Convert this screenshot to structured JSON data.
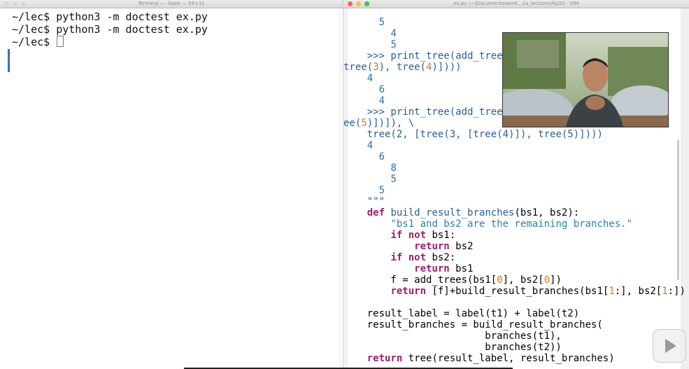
{
  "terminal": {
    "title": "Terminal — -bash — 54×31",
    "prompt": "~/lec$",
    "lines": [
      {
        "prompt": "~/lec$",
        "command": " python3 -m doctest ex.py"
      },
      {
        "prompt": "~/lec$",
        "command": " python3 -m doctest ex.py"
      },
      {
        "prompt": "~/lec$",
        "command": " "
      }
    ]
  },
  "vim": {
    "title": "ex.py (~/Documents/work...1a_lectures/fa20) - VIM",
    "tilde": "~"
  },
  "colors": {
    "number": "#2f6fb0",
    "literal": "#d77b1f",
    "keyword": "#9c1f6f",
    "string": "#2e7fb0"
  },
  "video": {
    "icon": "play-icon"
  }
}
